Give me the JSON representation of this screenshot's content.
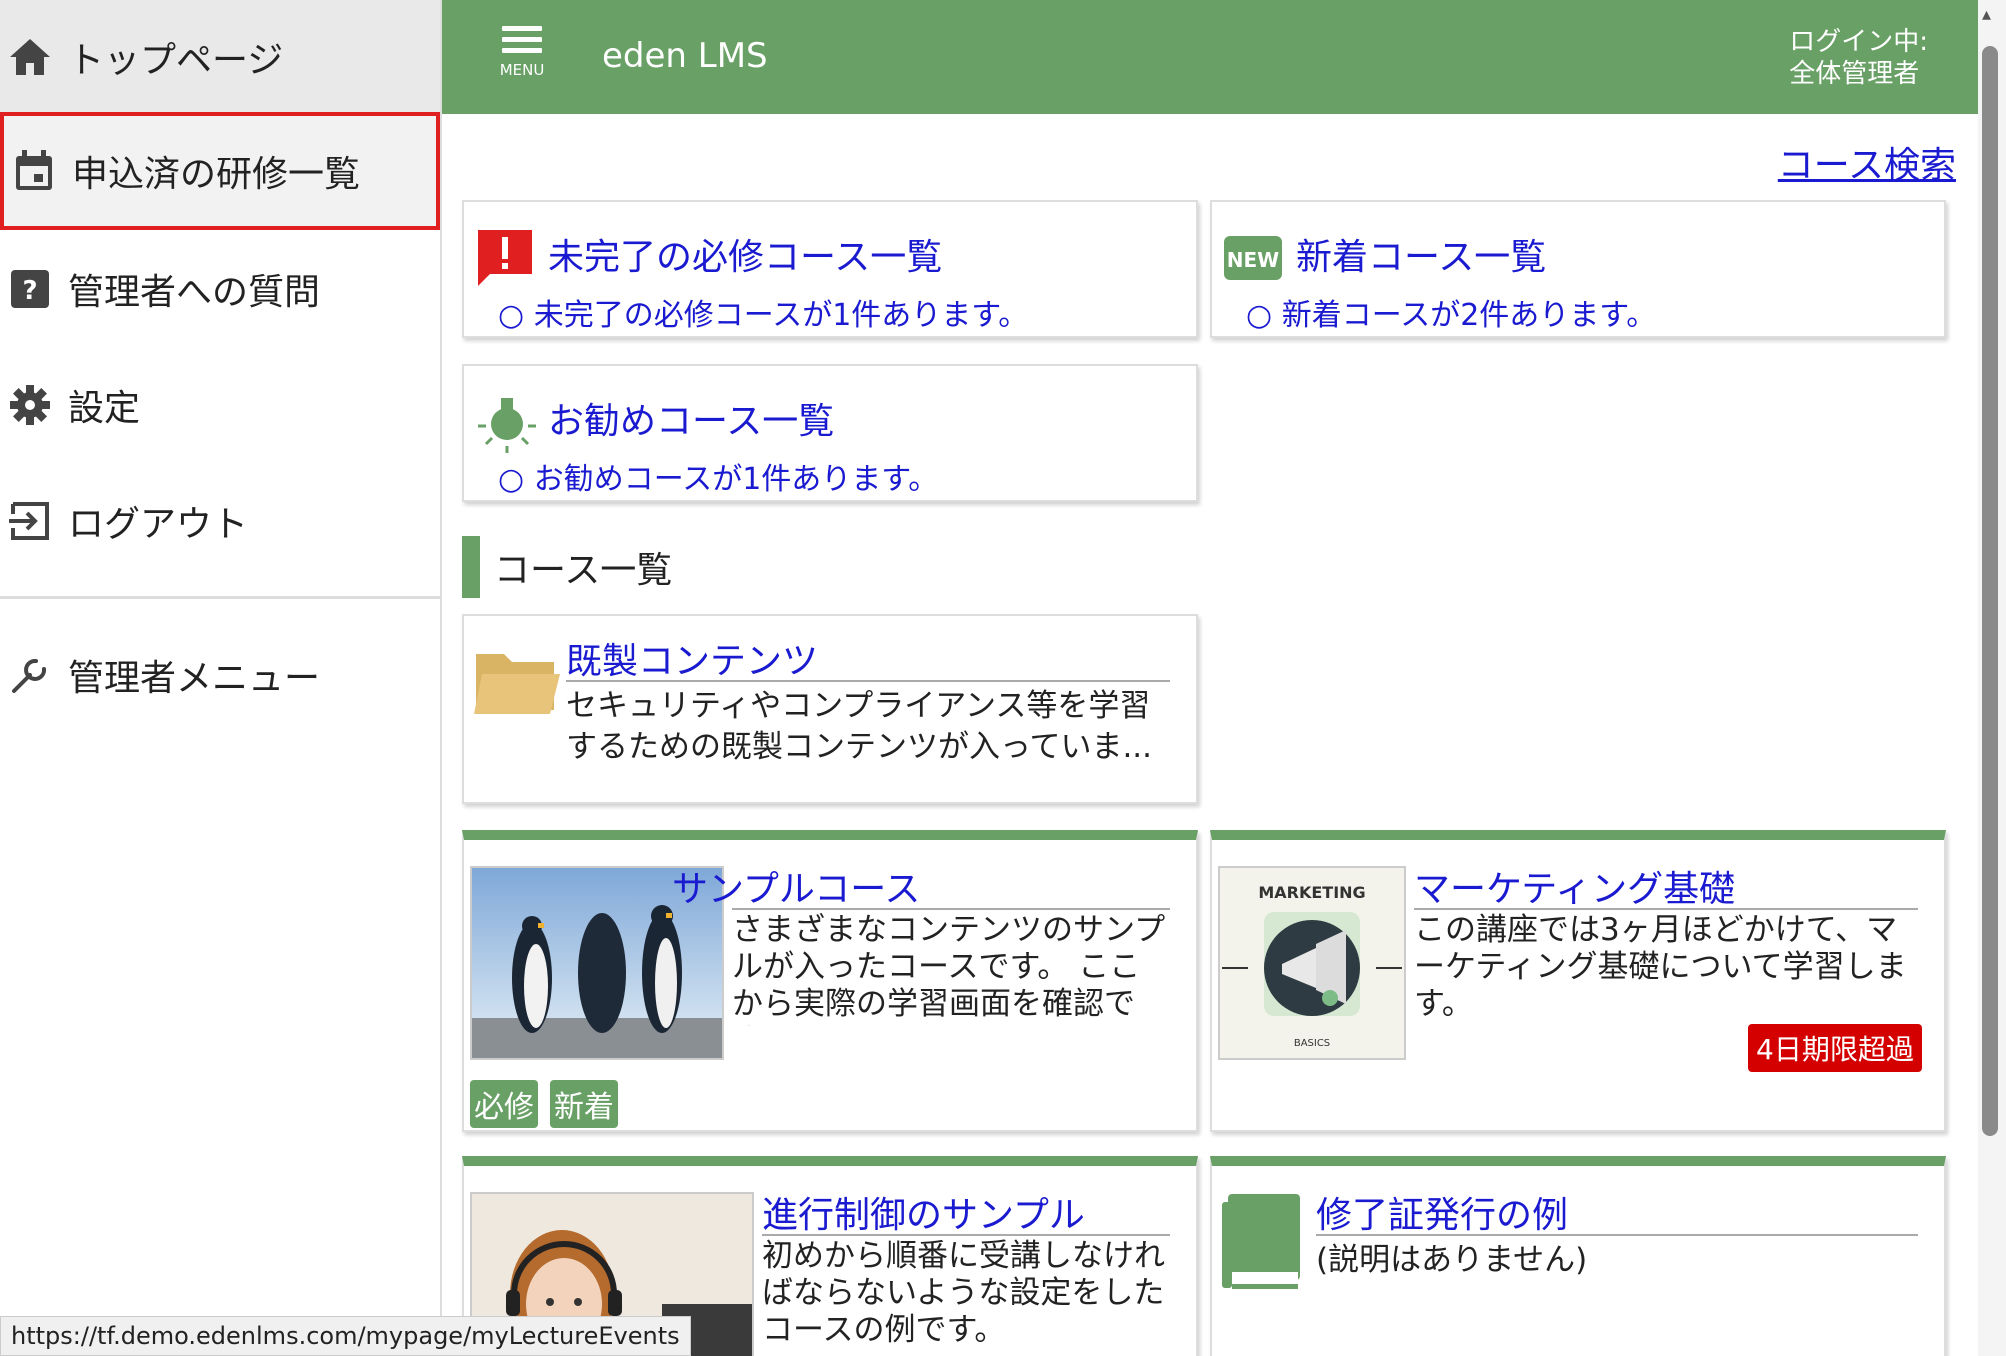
{
  "sidebar": {
    "home": "トップページ",
    "applied": "申込済の研修一覧",
    "question": "管理者への質問",
    "settings": "設定",
    "logout": "ログアウト",
    "admin_menu": "管理者メニュー"
  },
  "header": {
    "menu_label": "MENU",
    "app_title": "eden LMS",
    "login_line1": "ログイン中:",
    "login_line2": "全体管理者"
  },
  "main": {
    "course_search": "コース検索",
    "summaries": [
      {
        "title": "未完了の必修コース一覧",
        "bullet": "○ 未完了の必修コースが1件あります。"
      },
      {
        "title": "新着コース一覧",
        "bullet": "○ 新着コースが2件あります。"
      },
      {
        "title": "お勧めコース一覧",
        "bullet": "○ お勧めコースが1件あります。"
      }
    ],
    "new_icon_text": "NEW",
    "section_title": "コース一覧",
    "folder": {
      "title": "既製コンテンツ",
      "desc": "セキュリティやコンプライアンス等を学習するための既製コンテンツが入っていま..."
    },
    "courses": [
      {
        "title": "サンプルコース",
        "desc": "さまざまなコンテンツのサンプルが入ったコースです。 ここから実際の学習画面を確認でき...",
        "badges": [
          "必修",
          "新着"
        ]
      },
      {
        "title": "マーケティング基礎",
        "desc": "この講座では3ヶ月ほどかけて、マーケティング基礎について学習します。",
        "overdue": "4日期限超過",
        "thumb_top": "MARKETING",
        "thumb_bottom": "BASICS"
      },
      {
        "title": "進行制御のサンプル",
        "desc": "初めから順番に受講しなければならないような設定をしたコースの例です。"
      },
      {
        "title": "修了証発行の例",
        "desc": "(説明はありません)"
      }
    ]
  },
  "status_url": "https://tf.demo.edenlms.com/mypage/myLectureEvents",
  "colors": {
    "accent": "#68a065",
    "link": "#1a1ad0",
    "alert": "#e02020"
  }
}
